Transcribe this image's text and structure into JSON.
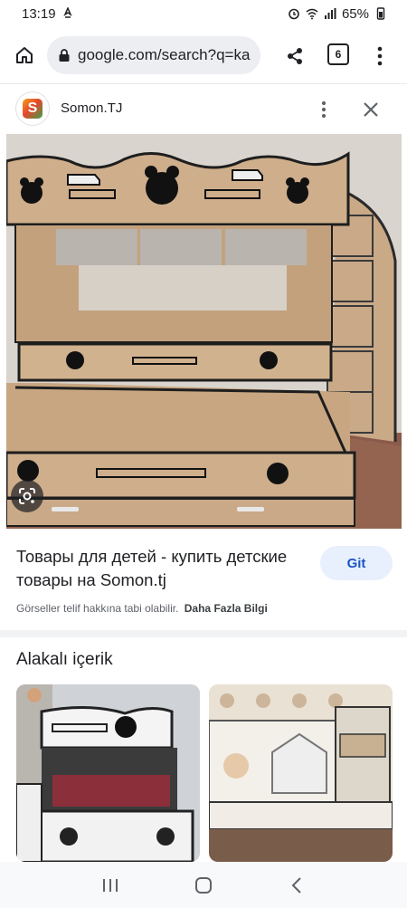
{
  "status_bar": {
    "time": "13:19",
    "battery": "65%"
  },
  "browser": {
    "url": "google.com/search?q=ka",
    "tab_count": "6"
  },
  "site": {
    "favicon_letter": "S",
    "name": "Somon.TJ"
  },
  "result": {
    "title": "Товары для детей - купить детские товары на Somon.tj",
    "visit_label": "Git",
    "copyright_notice": "Görseller telif hakkına tabi olabilir.",
    "more_info_link": "Daha Fazla Bilgi"
  },
  "related": {
    "heading": "Alakalı içerik"
  },
  "icons": {
    "home": "home-icon",
    "lock": "lock-icon",
    "share": "share-icon",
    "menu": "more-vert-icon",
    "close": "close-icon",
    "lens": "google-lens-icon",
    "recents": "recent-apps-icon",
    "nav_home": "nav-home-icon",
    "back": "back-icon"
  },
  "colors": {
    "accent": "#1a56c4",
    "visit_bg": "#e8f0fe"
  }
}
